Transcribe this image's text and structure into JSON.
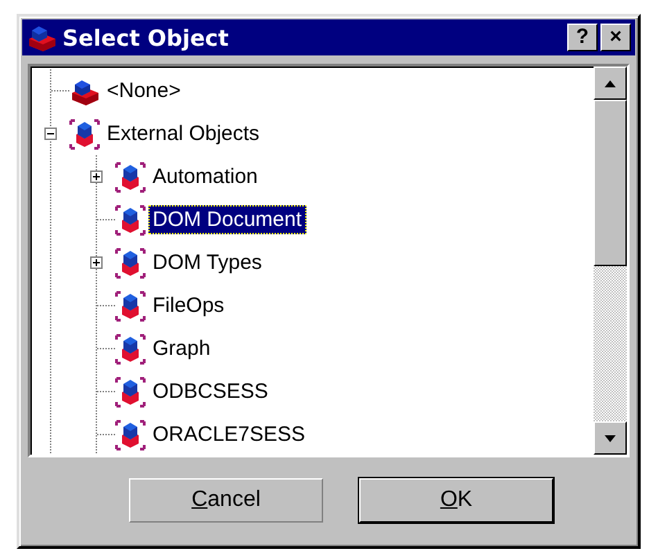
{
  "window": {
    "title": "Select Object",
    "help_button": "?",
    "close_button": "×"
  },
  "tree": [
    {
      "label": "<None>",
      "kind": "bricks",
      "selected": false
    },
    {
      "label": "External Objects",
      "kind": "object",
      "selected": false,
      "expanded": true,
      "children": [
        {
          "label": "Automation",
          "kind": "object",
          "selected": false,
          "expanded": false
        },
        {
          "label": "DOM Document",
          "kind": "object",
          "selected": true
        },
        {
          "label": "DOM Types",
          "kind": "object",
          "selected": false,
          "expanded": false
        },
        {
          "label": "FileOps",
          "kind": "object",
          "selected": false
        },
        {
          "label": "Graph",
          "kind": "object",
          "selected": false
        },
        {
          "label": "ODBCSESS",
          "kind": "object",
          "selected": false
        },
        {
          "label": "ORACLE7SESS",
          "kind": "object",
          "selected": false
        }
      ]
    }
  ],
  "buttons": [
    {
      "label": "Cancel",
      "default": false
    },
    {
      "label": "OK",
      "default": true
    }
  ]
}
